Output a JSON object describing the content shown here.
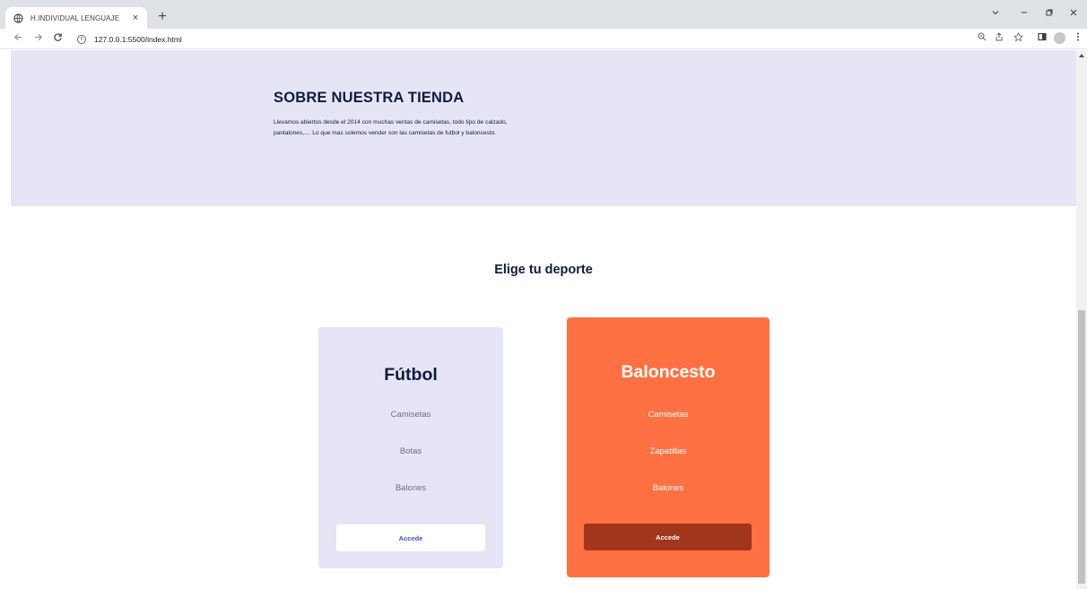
{
  "browser": {
    "tab_title": "H.INDIVIDUAL LENGUAJE",
    "tab_close": "×",
    "new_tab": "+",
    "url": "127.0.0.1:5500/index.html",
    "icons": [
      "back-arrow-icon",
      "forward-arrow-icon",
      "reload-icon",
      "site-info-icon",
      "zoom-icon",
      "share-icon",
      "star-icon",
      "side-panel-icon",
      "profile-icon",
      "menu-kebab-icon"
    ]
  },
  "about": {
    "heading": "SOBRE NUESTRA TIENDA",
    "text": "Llevamos abiertos desde el 2014 con muchas ventas de camisetas, todo tipo de calzado, pantalones,.... Lo que mas solemos vender son las camisetas de futbol y baloncesto."
  },
  "sports": {
    "title": "Elige tu deporte",
    "cards": [
      {
        "name": "Fútbol",
        "items": [
          "Camisetas",
          "Botas",
          "Balones"
        ],
        "button": "Accede",
        "color": "#e6e5f5"
      },
      {
        "name": "Baloncesto",
        "items": [
          "Camisetas",
          "Zapatillas",
          "Balones"
        ],
        "button": "Accede",
        "color": "#ff7043"
      }
    ]
  }
}
